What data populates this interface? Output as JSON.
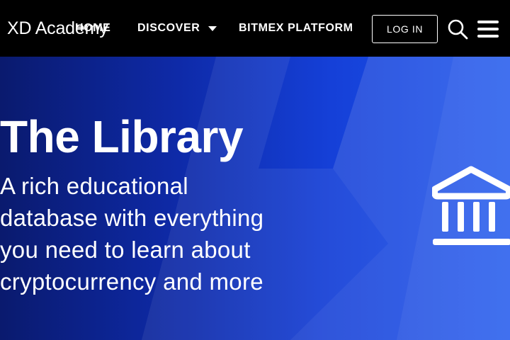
{
  "header": {
    "logo_text": "XD Academy",
    "nav": {
      "home": "HOME",
      "discover": "DISCOVER",
      "platform": "BITMEX PLATFORM"
    },
    "login_label": "LOG IN",
    "icons": [
      "search-icon",
      "hamburger-menu-icon"
    ]
  },
  "hero": {
    "title": "The Library",
    "subtitle": "A rich educational database with everything you need to learn about cryptocurrency and more",
    "icon": "bank-building-icon"
  },
  "colors": {
    "topbar": "#000000",
    "hero_gradient_start": "#0a1a6e",
    "hero_gradient_end": "#1e56ee",
    "text": "#ffffff"
  }
}
